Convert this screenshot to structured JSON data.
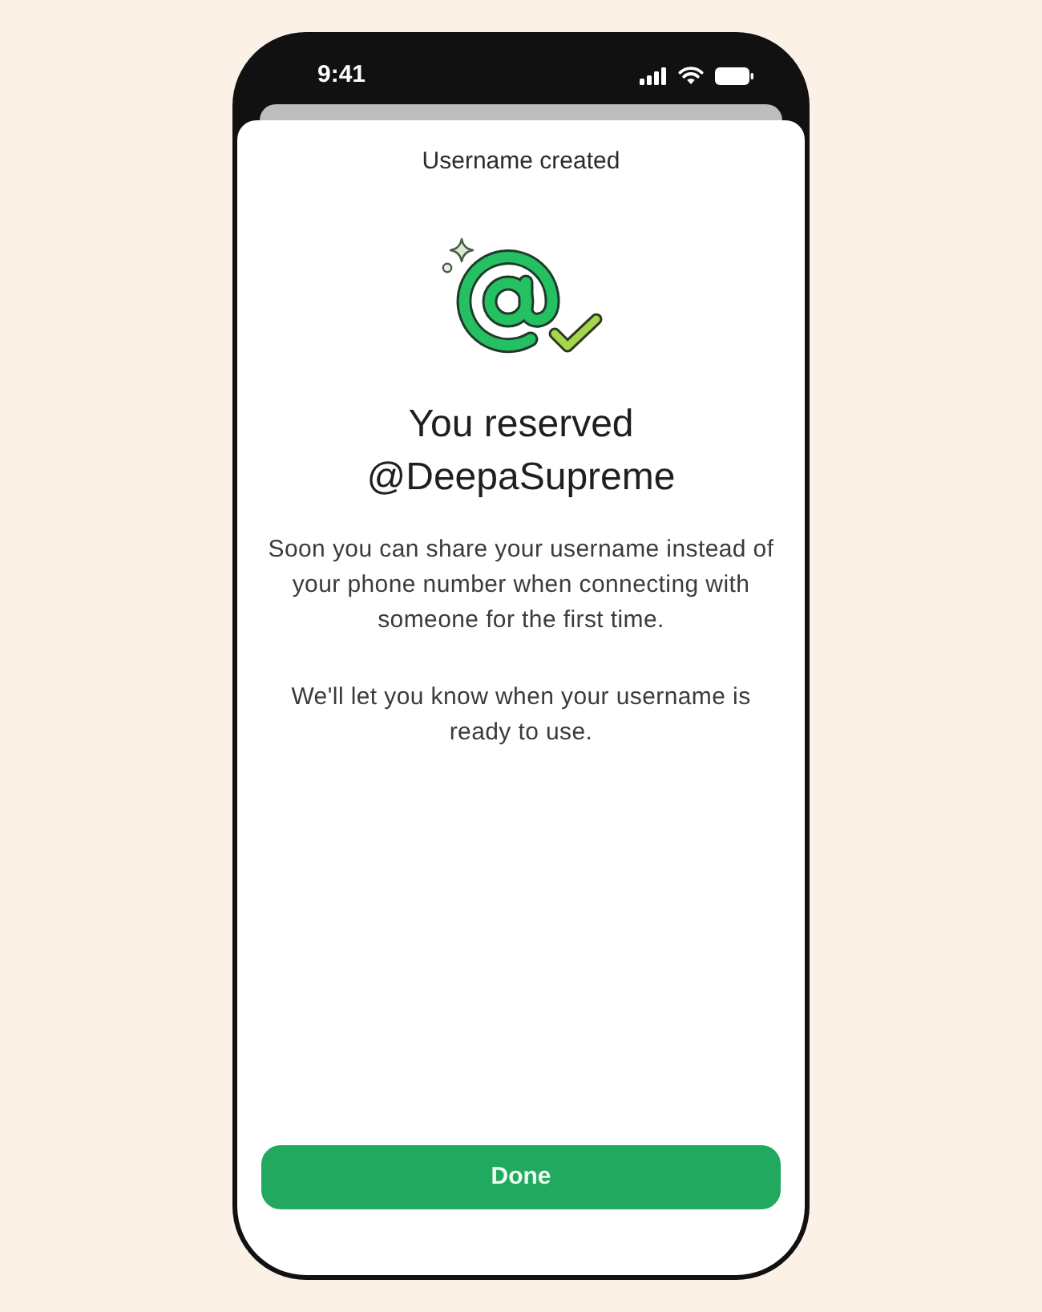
{
  "status_bar": {
    "time": "9:41"
  },
  "sheet": {
    "title": "Username created",
    "heading": "You reserved @DeepaSupreme",
    "paragraphs": [
      "Soon you can share your username instead of your phone number when connecting with someone for the first time.",
      "We'll let you know when your username is ready to use."
    ],
    "button": {
      "label": "Done"
    }
  }
}
